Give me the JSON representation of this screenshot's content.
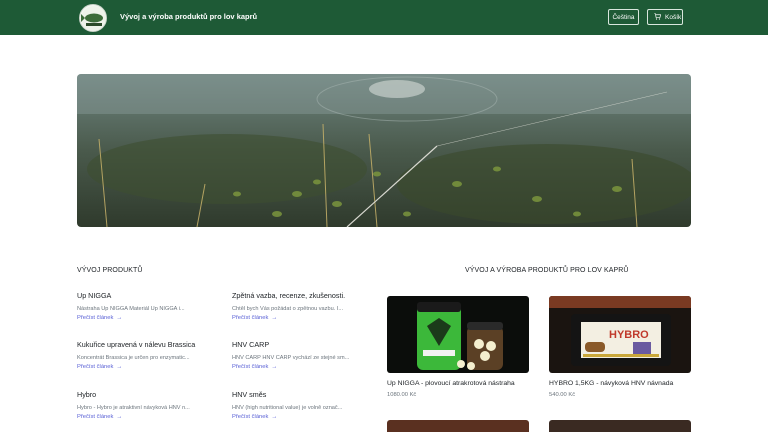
{
  "header": {
    "brand_title": "Vývoj a výroba produktů pro lov kaprů",
    "language_label": "Čeština",
    "cart_label": "Košík",
    "colors": {
      "bar": "#1e5a36"
    }
  },
  "hero": {
    "image_alt": ""
  },
  "articles_section": {
    "title": "VÝVOJ PRODUKTŮ",
    "read_more_label": "Přečíst článek",
    "items": [
      {
        "title": "Up NIGGA",
        "excerpt": "Nástraha Up NIGGA     Materiál Up NIGGA i..."
      },
      {
        "title": "Zpětná vazba, recenze, zkušenosti.",
        "excerpt": "Chtěl bych Vás požádat o zpětnou vazbu. I..."
      },
      {
        "title": "Kukuřice upravená v nálevu Brassica",
        "excerpt": "Koncentrát Brassica je určen pro enzymatic..."
      },
      {
        "title": "HNV CARP",
        "excerpt": "HNV CARP HNV CARP vychází ze stejné sm..."
      },
      {
        "title": "Hybro",
        "excerpt": "Hybro - Hybro je atraktivní návyková HNV n..."
      },
      {
        "title": "HNV směs",
        "excerpt": "HNV (high nutritional value) je volně označ..."
      }
    ]
  },
  "products_section": {
    "title": "VÝVOJ A VÝROBA PRODUKTŮ PRO LOV KAPRŮ",
    "items": [
      {
        "name": "Up NIGGA - plovoucí atrakrotová nástraha",
        "price": "1080.00 Kč"
      },
      {
        "name": "HYBRO 1,5KG - návyková HNV návnada",
        "price": "540.00 Kč",
        "label_text": "HYBRO"
      }
    ]
  }
}
